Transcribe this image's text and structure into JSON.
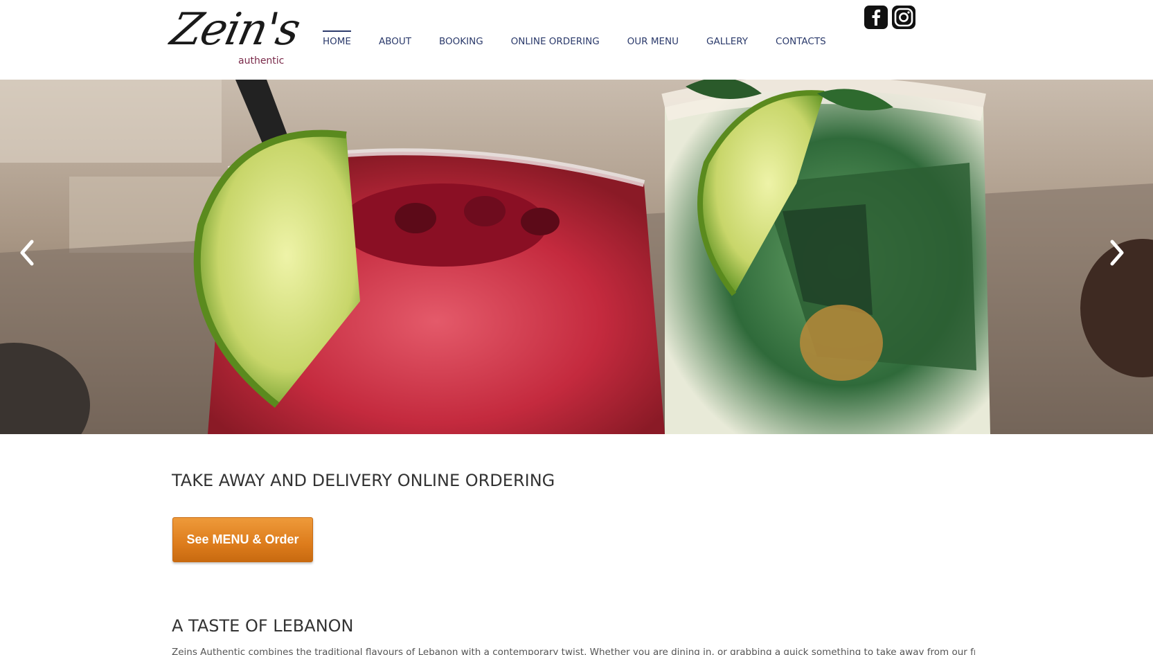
{
  "brand": {
    "logo_script": "Zein's",
    "logo_sub": "authentic"
  },
  "nav": {
    "items": [
      {
        "label": "HOME",
        "active": true
      },
      {
        "label": "ABOUT"
      },
      {
        "label": "BOOKING"
      },
      {
        "label": "ONLINE ORDERING"
      },
      {
        "label": "OUR MENU"
      },
      {
        "label": "GALLERY"
      },
      {
        "label": "CONTACTS"
      }
    ]
  },
  "social": {
    "icons": [
      "facebook-icon",
      "instagram-icon"
    ]
  },
  "hero": {
    "image_description": "Two cocktails with lime wedges: a red pomegranate drink and a green mint drink with sugared rim",
    "prev_icon": "chevron-left-icon",
    "next_icon": "chevron-right-icon"
  },
  "ordering": {
    "title": "TAKE AWAY AND DELIVERY ONLINE ORDERING",
    "button_label": "See MENU & Order",
    "button_color": "#dd7c1c"
  },
  "about": {
    "title": "A TASTE OF LEBANON",
    "intro": "Zeins Authentic combines the traditional flavours of Lebanon with a contemporary twist. Whether you are dining in, or grabbing a quick something to take away from our fresh"
  },
  "colors": {
    "nav_text": "#2b3a6b",
    "accent": "#dd7c1c"
  }
}
